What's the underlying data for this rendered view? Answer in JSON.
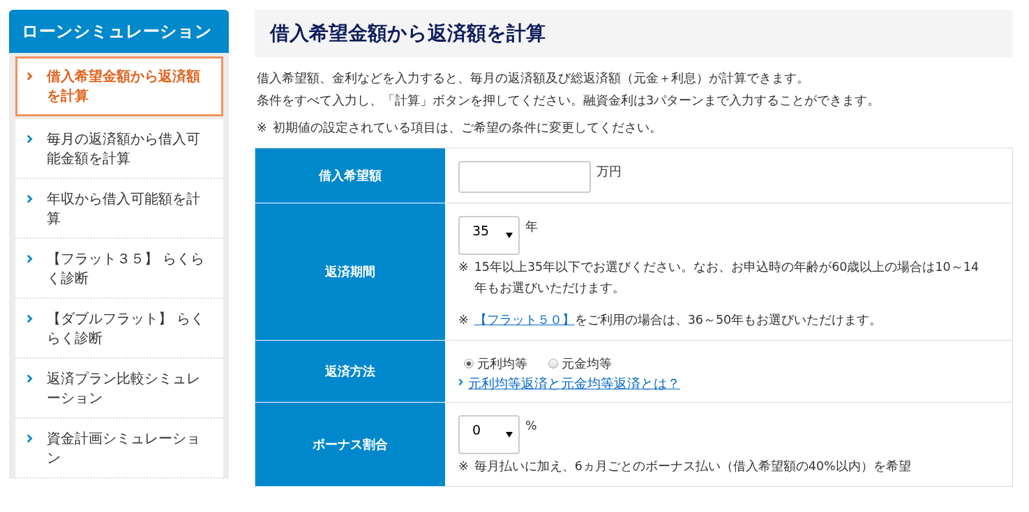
{
  "sidebar": {
    "title": "ローンシミュレーション",
    "items": [
      {
        "label": "借入希望金額から返済額を計算",
        "selected": true
      },
      {
        "label": "毎月の返済額から借入可能金額を計算",
        "selected": false
      },
      {
        "label": "年収から借入可能額を計算",
        "selected": false
      },
      {
        "label": "【フラット３５】 らくらく診断",
        "selected": false
      },
      {
        "label": "【ダブルフラット】 らくらく診断",
        "selected": false
      },
      {
        "label": "返済プラン比較シミュレーション",
        "selected": false
      },
      {
        "label": "資金計画シミュレーション",
        "selected": false
      }
    ]
  },
  "main": {
    "title": "借入希望金額から返済額を計算",
    "intro": [
      "借入希望額、金利などを入力すると、毎月の返済額及び総返済額（元金＋利息）が計算できます。",
      "条件をすべて入力し、「計算」ボタンを押してください。融資金利は3パターンまで入力することができます。"
    ],
    "note": {
      "mark": "※",
      "text": "初期値の設定されている項目は、ご希望の条件に変更してください。"
    },
    "form": [
      {
        "kind": "text",
        "label": "借入希望額",
        "unit": "万円"
      },
      {
        "kind": "select",
        "label": "返済期間",
        "value": "35",
        "unit": "年",
        "notes": [
          {
            "mark": "※",
            "text": "15年以上35年以下でお選びください。なお、お申込時の年齢が60歳以上の場合は10～14年もお選びいただけます。"
          },
          {
            "mark": "※",
            "link": "【フラット５０】",
            "text": "をご利用の場合は、36～50年もお選びいただけます。"
          }
        ]
      },
      {
        "kind": "radio",
        "label": "返済方法",
        "options": [
          {
            "label": "元利均等",
            "selected": true
          },
          {
            "label": "元金均等",
            "selected": false
          }
        ],
        "link": "元利均等返済と元金均等返済とは？"
      },
      {
        "kind": "select",
        "label": "ボーナス割合",
        "value": "0",
        "unit": "%",
        "notes": [
          {
            "mark": "※",
            "text": "毎月払いに加え、6ヵ月ごとのボーナス払い（借入希望額の40%以内）を希望"
          }
        ]
      }
    ]
  }
}
